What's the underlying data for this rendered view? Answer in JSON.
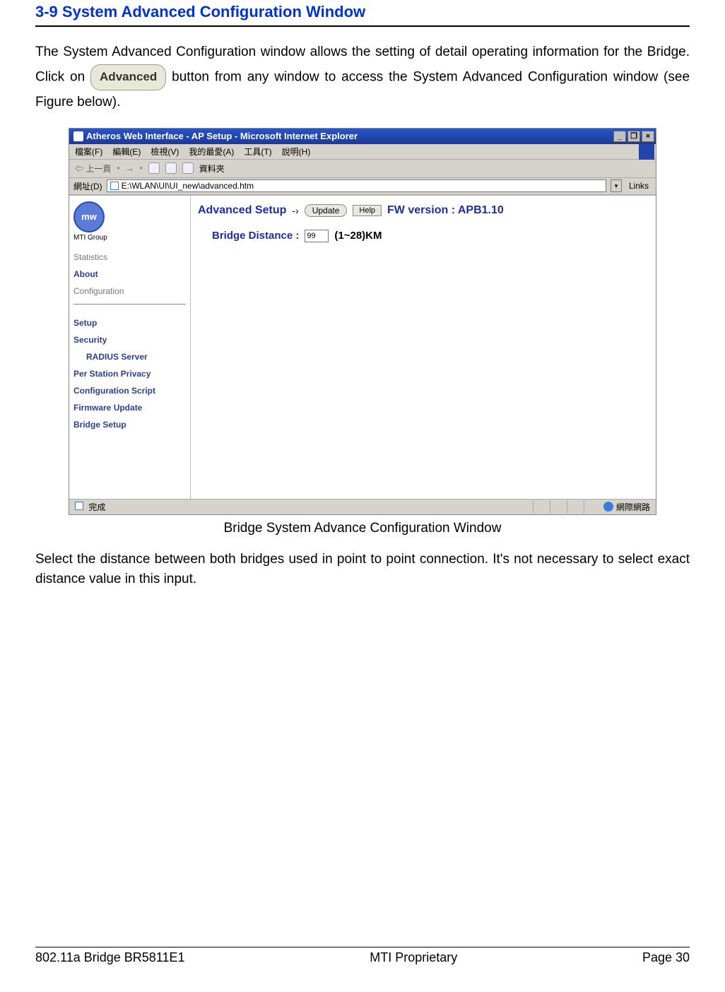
{
  "section_title": "3-9 System Advanced Configuration Window",
  "intro": {
    "pre": "The System Advanced Configuration window allows the setting of detail operating information for the Bridge. Click on ",
    "btn": "Advanced",
    "post": " button from any window to access the System Advanced Configuration window (see Figure below)."
  },
  "ie": {
    "title": "Atheros Web Interface - AP Setup - Microsoft Internet Explorer",
    "win": {
      "min": "_",
      "max": "❐",
      "close": "×"
    },
    "menu": {
      "file": "檔案(F)",
      "edit": "編輯(E)",
      "view": "檢視(V)",
      "fav": "我的最愛(A)",
      "tools": "工具(T)",
      "help": "說明(H)"
    },
    "toolbar": {
      "back": "上一頁",
      "favbtn": "資料夾"
    },
    "addr": {
      "label": "網址(D)",
      "value": "E:\\WLAN\\UI\\UI_new\\advanced.htm",
      "links": "Links"
    },
    "sidebar": {
      "logo_text": "mw",
      "logo_label": "MTI Group",
      "items": {
        "stats": "Statistics",
        "about": "About",
        "config": "Configuration",
        "setup": "Setup",
        "security": "Security",
        "radius": "RADIUS Server",
        "psp": "Per Station Privacy",
        "cscript": "Configuration Script",
        "fw": "Firmware Update",
        "bridge": "Bridge Setup"
      }
    },
    "content": {
      "heading": "Advanced Setup",
      "arrow": "-›",
      "update": "Update",
      "help": "Help",
      "fw_label": "FW version : APB1.10",
      "field_label": "Bridge Distance :",
      "field_value": "99",
      "range": "(1~28)KM"
    },
    "status": {
      "done": "完成",
      "zone": "網際網路"
    }
  },
  "caption": "Bridge System Advance Configuration Window",
  "after": "Select the distance between both bridges used in point to point connection. It's not necessary to select exact distance value in this input.",
  "footer": {
    "left": "802.11a Bridge BR5811E1",
    "center": "MTI Proprietary",
    "right": "Page 30"
  }
}
